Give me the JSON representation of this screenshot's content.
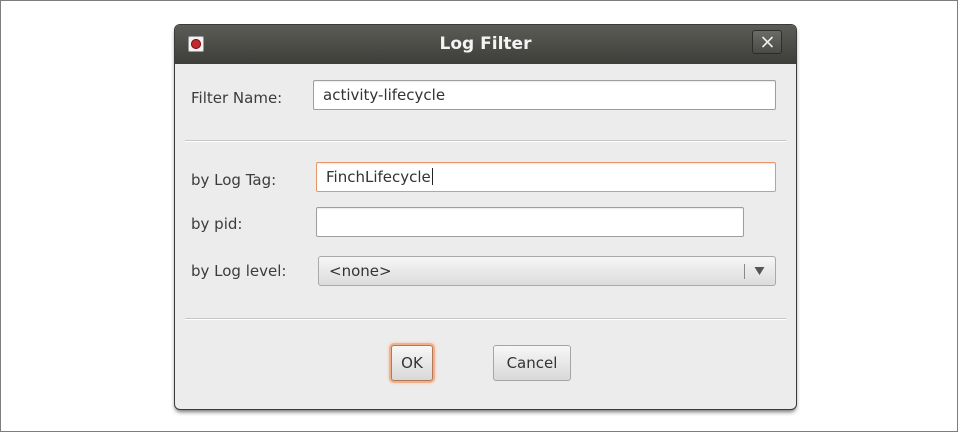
{
  "dialog": {
    "title": "Log Filter",
    "close_label": "✕"
  },
  "form": {
    "filter_name": {
      "label": "Filter Name:",
      "value": "activity-lifecycle"
    },
    "log_tag": {
      "label": "by Log Tag:",
      "value": "FinchLifecycle"
    },
    "pid": {
      "label": "by pid:",
      "value": ""
    },
    "log_level": {
      "label": "by Log level:",
      "selected": "<none>",
      "arrow": "▼"
    }
  },
  "buttons": {
    "ok_label": "OK",
    "cancel_label": "Cancel"
  },
  "colors": {
    "focus_accent": "#e8956b",
    "titlebar": "#4a4a46",
    "dialog_bg": "#ececec",
    "app_icon": "#c1272d"
  },
  "icons": {
    "app": "app-icon",
    "close": "close-icon",
    "dropdown": "chevron-down-icon"
  }
}
